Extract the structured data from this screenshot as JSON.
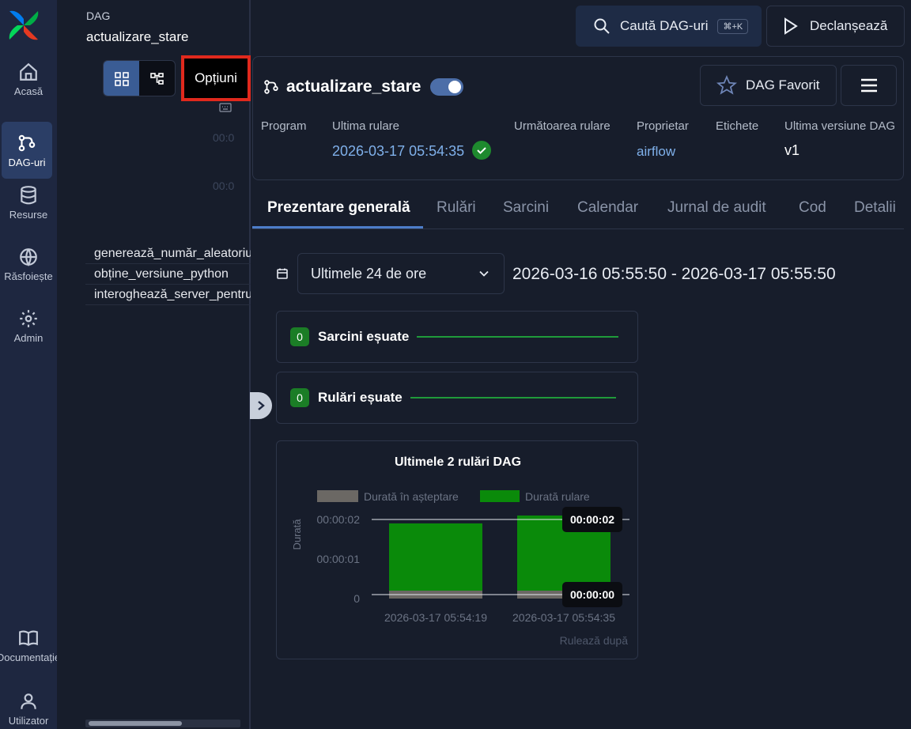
{
  "nav": {
    "items": [
      {
        "label": "Acasă",
        "icon": "home-icon"
      },
      {
        "label": "DAG-uri",
        "icon": "dag-icon",
        "active": true
      },
      {
        "label": "Resurse",
        "icon": "database-icon"
      },
      {
        "label": "Răsfoiește",
        "icon": "globe-icon"
      },
      {
        "label": "Admin",
        "icon": "gear-icon"
      }
    ],
    "bottom": [
      {
        "label": "Documentație",
        "icon": "book-icon"
      },
      {
        "label": "Utilizator",
        "icon": "user-icon"
      }
    ]
  },
  "breadcrumb": {
    "section": "DAG",
    "name": "actualizare_stare"
  },
  "grid_panel": {
    "options_label": "Opțiuni",
    "time_labels": [
      "00:0",
      "00:0"
    ],
    "tasks": [
      "generează_număr_aleatoriu",
      "obține_versiune_python",
      "interoghează_server_pentru_stare"
    ]
  },
  "topbar": {
    "search_label": "Caută DAG-uri",
    "search_shortcut": "⌘+K",
    "trigger_label": "Declanșează"
  },
  "dag": {
    "title": "actualizare_stare",
    "paused": false,
    "favorite_label": "DAG Favorit",
    "meta": {
      "schedule_label": "Program",
      "last_run_label": "Ultima rulare",
      "last_run_value": "2026-03-17 05:54:35",
      "next_run_label": "Următoarea rulare",
      "owner_label": "Proprietar",
      "owner_value": "airflow",
      "tags_label": "Etichete",
      "version_label": "Ultima versiune DAG",
      "version_value": "v1"
    }
  },
  "tabs": [
    "Prezentare generală",
    "Rulări",
    "Sarcini",
    "Calendar",
    "Jurnal de audit",
    "Cod",
    "Detalii"
  ],
  "range": {
    "selected": "Ultimele 24 de ore",
    "text": "2026-03-16 05:55:50 - 2026-03-17 05:55:50"
  },
  "stats": [
    {
      "count": "0",
      "label": "Sarcini eșuate"
    },
    {
      "count": "0",
      "label": "Rulări eșuate"
    }
  ],
  "colors": {
    "success": "#1e8a2e",
    "accent": "#4d7dc9",
    "queued": "#6b6864",
    "running": "#0a8a0a"
  },
  "chart_data": {
    "type": "bar",
    "title": "Ultimele 2 rulări DAG",
    "categories": [
      "2026-03-17 05:54:19",
      "2026-03-17 05:54:35"
    ],
    "series": [
      {
        "name": "Durată în așteptare",
        "values": [
          0.2,
          0.2
        ]
      },
      {
        "name": "Durată rulare",
        "values": [
          1.7,
          1.9
        ]
      }
    ],
    "xlabel": "Rulează după",
    "ylabel": "Durată",
    "yticks": [
      "0",
      "00:00:01",
      "00:00:02"
    ],
    "ylim": [
      0,
      2.2
    ],
    "reference_lines": [
      {
        "value": 2.0,
        "label": "00:00:02"
      },
      {
        "value": 0.1,
        "label": "00:00:00"
      }
    ],
    "stacked": true,
    "legend": "top"
  }
}
